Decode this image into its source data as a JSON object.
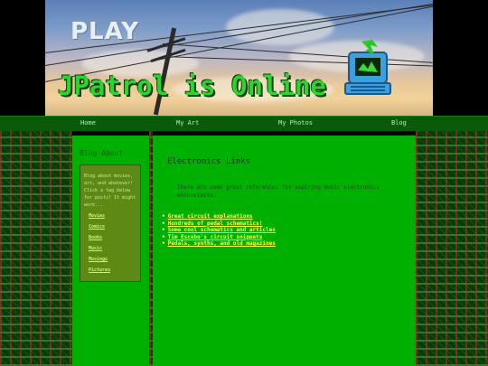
{
  "banner": {
    "play_text": "PLAY",
    "title": "JPatrol is Online"
  },
  "nav": {
    "items": [
      {
        "label": "Home"
      },
      {
        "label": "My Art"
      },
      {
        "label": "My Photos"
      },
      {
        "label": "Blog"
      }
    ]
  },
  "sidebar": {
    "title": "Blog About",
    "blurb": "Blog about movies, art, and whatever! Click a tag below for posts! It might work...",
    "links": [
      {
        "label": "Movies"
      },
      {
        "label": "Comics"
      },
      {
        "label": "Books"
      },
      {
        "label": "Music"
      },
      {
        "label": "Musings"
      },
      {
        "label": "Pictures"
      }
    ]
  },
  "main": {
    "title": "Electronics Links",
    "intro": "There are some great references for aspiring music electronics enthusiasts.",
    "links": [
      {
        "label": "Great circuit explanations"
      },
      {
        "label": "Hundreds of pedal schematics!"
      },
      {
        "label": "Some cool schematics and articles"
      },
      {
        "label": "Tim Escobo's circuit snippets"
      },
      {
        "label": "Pedals, synths, and old magazines"
      }
    ]
  },
  "colors": {
    "page_bg": "#000000",
    "content_green": "#00b000",
    "nav_green": "#0a5a0a",
    "sidebar_box": "#5c8a14",
    "link_yellow": "#ffff44",
    "title_green": "#2ad62a"
  }
}
